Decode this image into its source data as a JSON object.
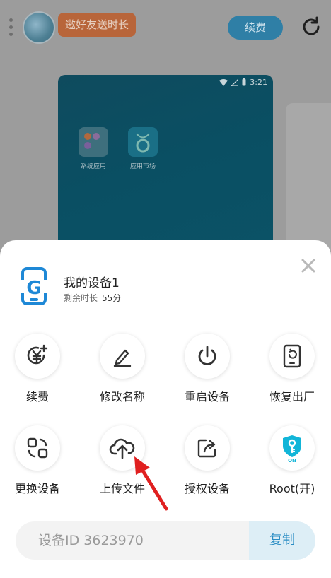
{
  "header": {
    "invite_label": "邀好友送时长",
    "renew_label": "续费"
  },
  "phone_screen": {
    "time": "3:21",
    "apps": [
      {
        "label": "系统应用"
      },
      {
        "label": "应用市场"
      }
    ]
  },
  "sheet": {
    "device_name": "我的设备1",
    "remaining_label": "剩余时长",
    "remaining_value": "55分",
    "actions": [
      {
        "label": "续费",
        "icon": "yen-plus-icon"
      },
      {
        "label": "修改名称",
        "icon": "pencil-icon"
      },
      {
        "label": "重启设备",
        "icon": "power-icon"
      },
      {
        "label": "恢复出厂",
        "icon": "factory-reset-icon"
      },
      {
        "label": "更换设备",
        "icon": "swap-device-icon"
      },
      {
        "label": "上传文件",
        "icon": "cloud-upload-icon"
      },
      {
        "label": "授权设备",
        "icon": "share-icon"
      },
      {
        "label": "Root(开)",
        "icon": "root-shield-icon",
        "badge": "ON"
      }
    ],
    "device_id_text": "设备ID 3623970",
    "copy_label": "复制"
  },
  "colors": {
    "accent": "#2a8dc4",
    "root_teal": "#12b5d8",
    "arrow_red": "#e02020"
  }
}
